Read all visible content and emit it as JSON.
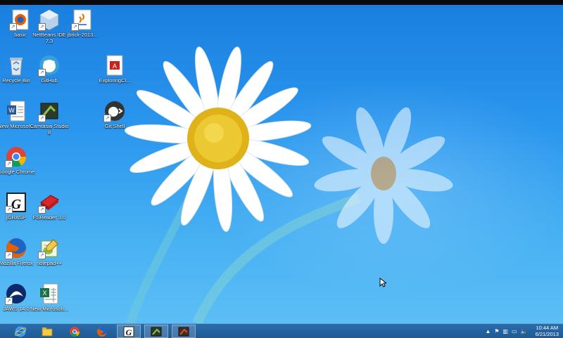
{
  "desktop": {
    "icons": [
      {
        "label": "basic",
        "icon": "firefox-icon"
      },
      {
        "label": "NetBeans IDE 7.3",
        "icon": "netbeans-icon"
      },
      {
        "label": "jbrick-2013...",
        "icon": "java-icon"
      },
      {
        "label": "Recycle Bin",
        "icon": "recycle-bin-icon"
      },
      {
        "label": "GitHub",
        "icon": "github-icon"
      },
      {
        "label": "ExploringCl...",
        "icon": "pdf-icon"
      },
      {
        "label": "New Microsof...",
        "icon": "word-doc-icon"
      },
      {
        "label": "Camtasia Studio 8",
        "icon": "camtasia-icon"
      },
      {
        "label": "Git Shell",
        "icon": "git-shell-icon"
      },
      {
        "label": "Google Chrome",
        "icon": "chrome-icon"
      },
      {
        "label": "jGRASP",
        "icon": "jgrasp-icon"
      },
      {
        "label": "FSReader 3.0",
        "icon": "fsreader-icon"
      },
      {
        "label": "Mozilla Firefox",
        "icon": "firefox-icon"
      },
      {
        "label": "notepad++",
        "icon": "notepad-plus-icon"
      },
      {
        "label": "JAWS 14.0",
        "icon": "jaws-icon"
      },
      {
        "label": "New Microsoft...",
        "icon": "excel-doc-icon"
      }
    ]
  },
  "taskbar": {
    "pinned": [
      {
        "name": "Internet Explorer",
        "icon": "internet-explorer-icon"
      },
      {
        "name": "File Explorer",
        "icon": "file-explorer-icon"
      },
      {
        "name": "Google Chrome",
        "icon": "chrome-icon"
      },
      {
        "name": "Mozilla Firefox",
        "icon": "firefox-icon"
      },
      {
        "name": "jGRASP",
        "icon": "jgrasp-icon"
      },
      {
        "name": "Camtasia Studio",
        "icon": "camtasia-icon"
      },
      {
        "name": "Camtasia Recorder",
        "icon": "camtasia-recorder-icon"
      }
    ],
    "clock": {
      "time": "10:44 AM",
      "date": "6/21/2013"
    }
  }
}
